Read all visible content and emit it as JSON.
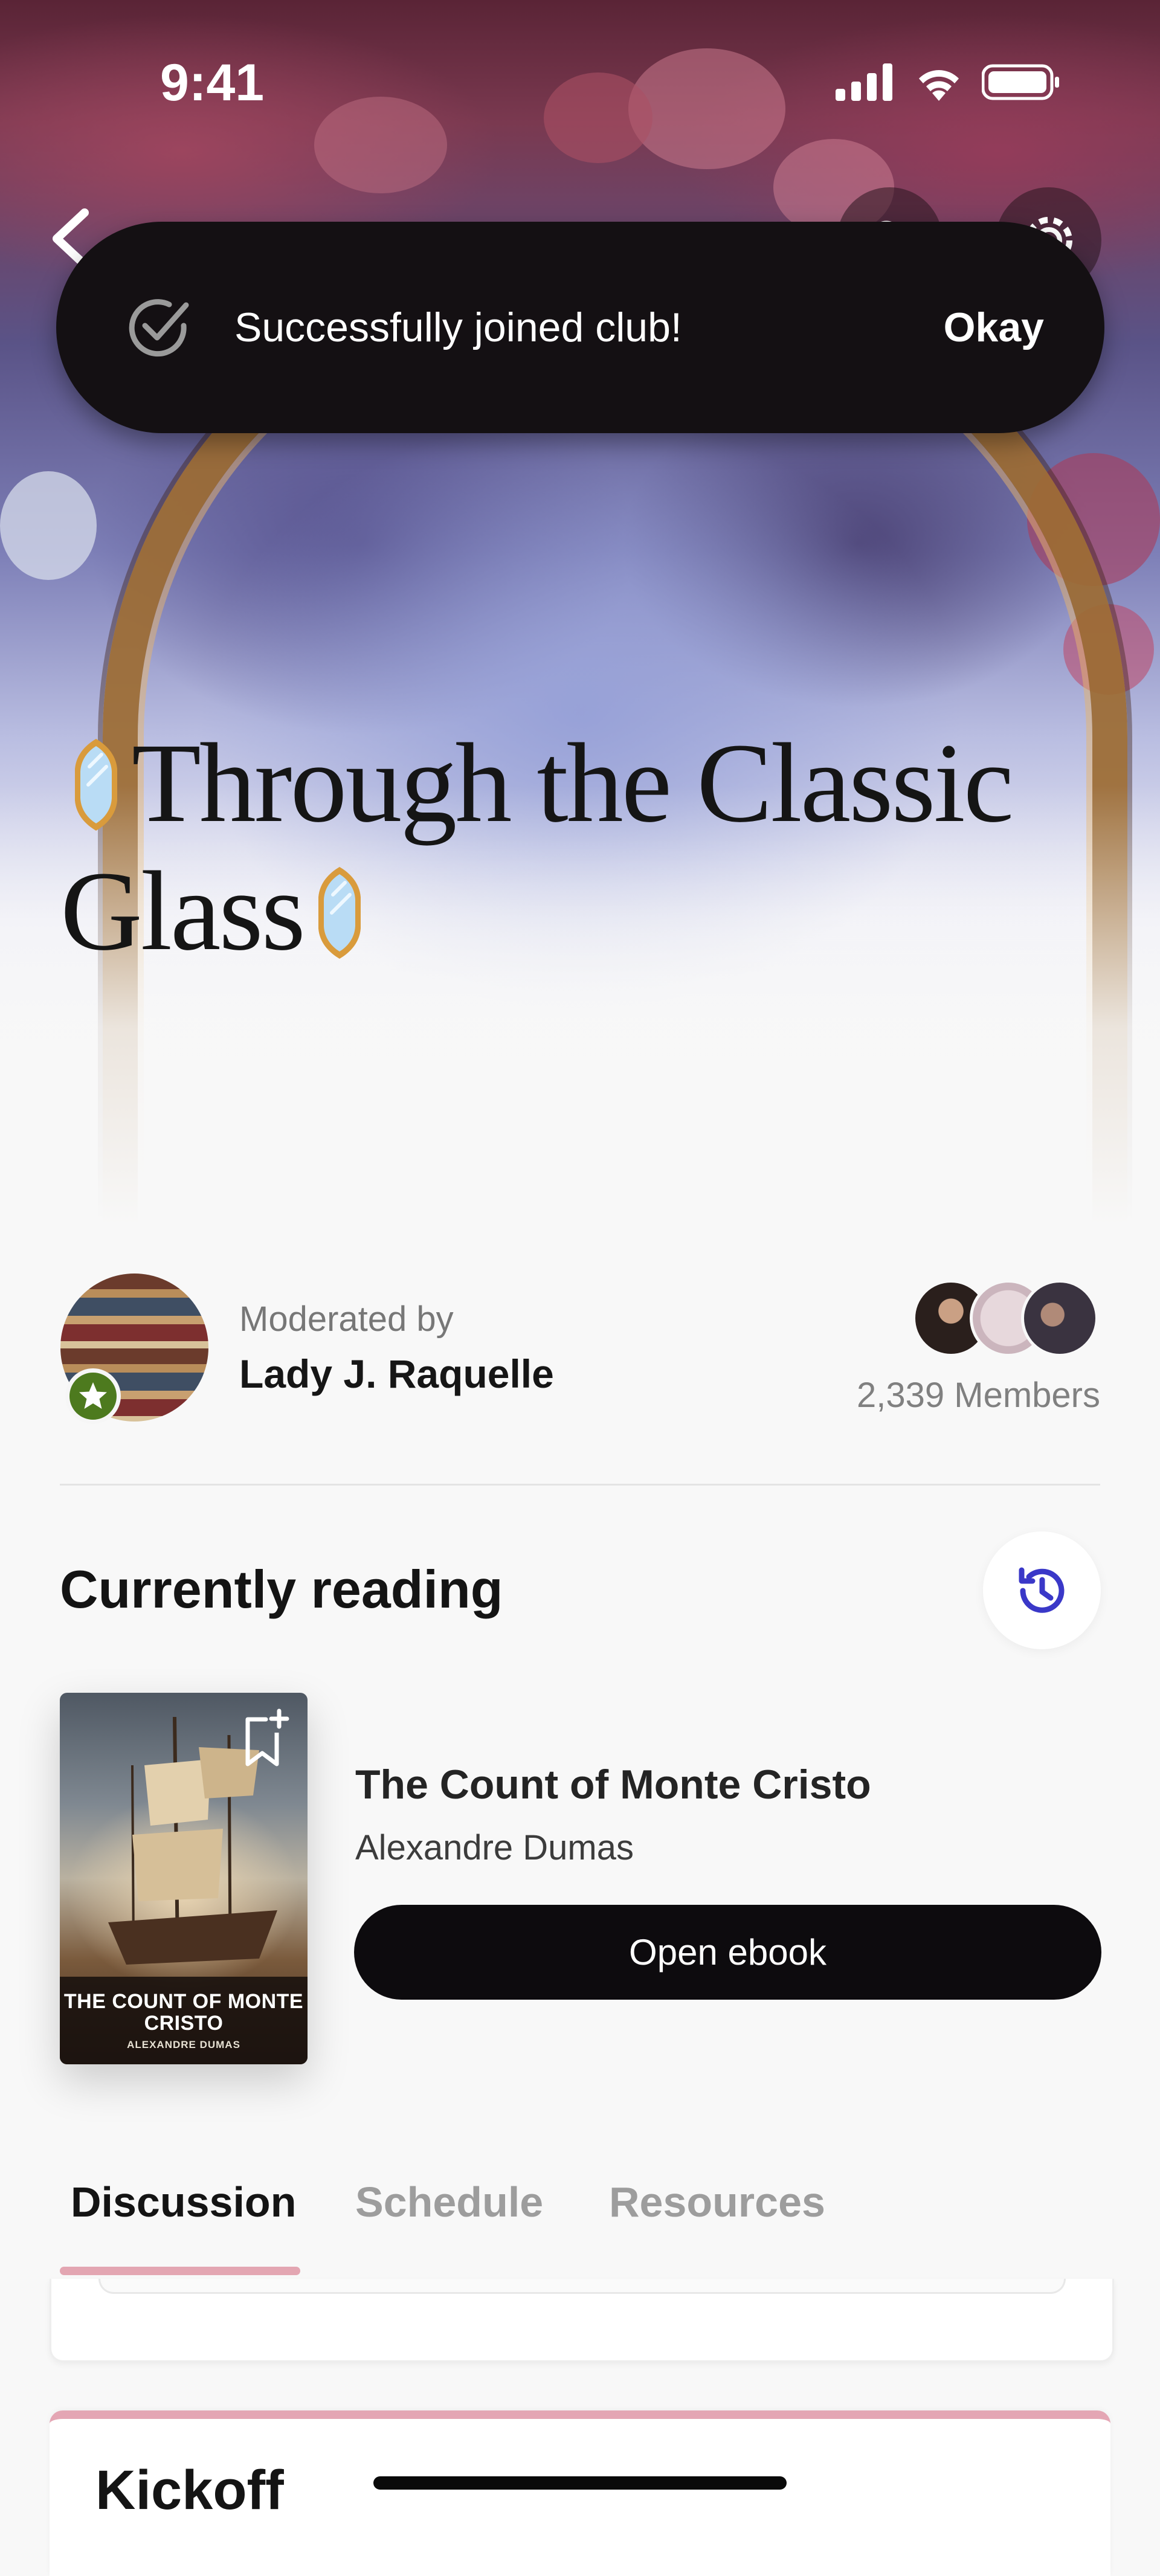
{
  "status_bar": {
    "time": "9:41"
  },
  "toast": {
    "message": "Successfully joined club!",
    "action_label": "Okay"
  },
  "club": {
    "title": "Through the Classic Glass",
    "moderator_label": "Moderated by",
    "moderator_name": "Lady J. Raquelle",
    "members_count": "2,339 Members"
  },
  "currently_reading": {
    "section_title": "Currently reading",
    "book": {
      "title": "The Count of Monte Cristo",
      "author": "Alexandre Dumas",
      "cover_title": "THE COUNT OF MONTE CRISTO",
      "cover_author": "ALEXANDRE DUMAS",
      "open_label": "Open ebook"
    }
  },
  "tabs": [
    {
      "label": "Discussion",
      "active": true
    },
    {
      "label": "Schedule",
      "active": false
    },
    {
      "label": "Resources",
      "active": false
    }
  ],
  "kickoff": {
    "title": "Kickoff"
  },
  "colors": {
    "accent_pink": "#e4a6b4",
    "history_icon": "#3a38c8",
    "moderator_badge": "#4d7a1e",
    "toast_bg": "#141013"
  }
}
